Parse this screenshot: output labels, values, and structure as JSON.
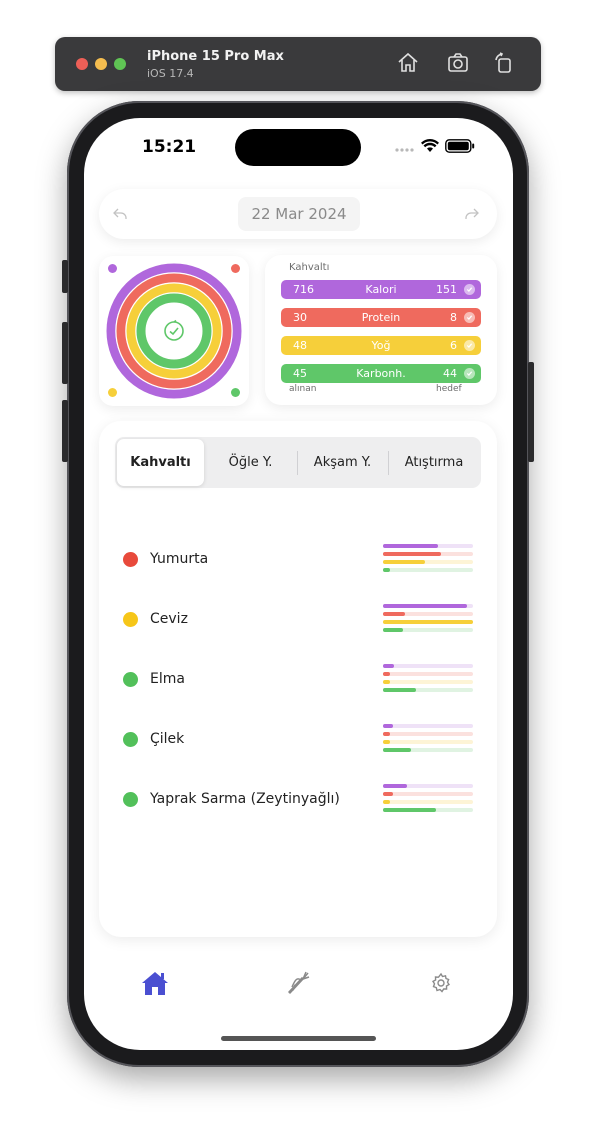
{
  "simulator": {
    "device": "iPhone 15 Pro Max",
    "os": "iOS 17.4",
    "icons": [
      "home-icon",
      "screenshot-icon",
      "rotate-icon"
    ]
  },
  "status_bar": {
    "time": "15:21"
  },
  "date_bar": {
    "date": "22 Mar 2024",
    "icons": [
      "back-arrow-icon",
      "forward-arrow-icon"
    ]
  },
  "colors": {
    "calorie": "#b067dc",
    "protein": "#ef6a5e",
    "fat": "#f6cf3a",
    "carb": "#5fc769",
    "nav_active": "#4a4fd1"
  },
  "rings": {
    "center_icon": "refresh-check-icon"
  },
  "macros": {
    "title": "Kahvaltı",
    "rows": [
      {
        "taken": "716",
        "label": "Kalori",
        "goal": "151"
      },
      {
        "taken": "30",
        "label": "Protein",
        "goal": "8"
      },
      {
        "taken": "48",
        "label": "Yoğ",
        "goal": "6"
      },
      {
        "taken": "45",
        "label": "Karbonh.",
        "goal": "44"
      }
    ],
    "footer_left": "alınan",
    "footer_right": "hedef"
  },
  "meal_tabs": [
    {
      "label": "Kahvaltı",
      "active": true
    },
    {
      "label": "Öğle Y.",
      "active": false
    },
    {
      "label": "Akşam Y.",
      "active": false
    },
    {
      "label": "Atıştırma",
      "active": false
    }
  ],
  "foods": [
    {
      "name": "Yumurta",
      "dot": "#e84a3b",
      "levels": [
        0.61,
        0.64,
        0.47,
        0.08
      ]
    },
    {
      "name": "Ceviz",
      "dot": "#f6c619",
      "levels": [
        0.93,
        0.24,
        1.0,
        0.22
      ]
    },
    {
      "name": "Elma",
      "dot": "#52c05a",
      "levels": [
        0.12,
        0.08,
        0.08,
        0.37
      ]
    },
    {
      "name": "Çilek",
      "dot": "#52c05a",
      "levels": [
        0.11,
        0.08,
        0.08,
        0.31
      ]
    },
    {
      "name": "Yaprak Sarma (Zeytinyağlı)",
      "dot": "#52c05a",
      "levels": [
        0.27,
        0.11,
        0.08,
        0.59
      ]
    }
  ],
  "bottom_nav": [
    "home-icon",
    "carrot-icon",
    "gear-icon"
  ]
}
